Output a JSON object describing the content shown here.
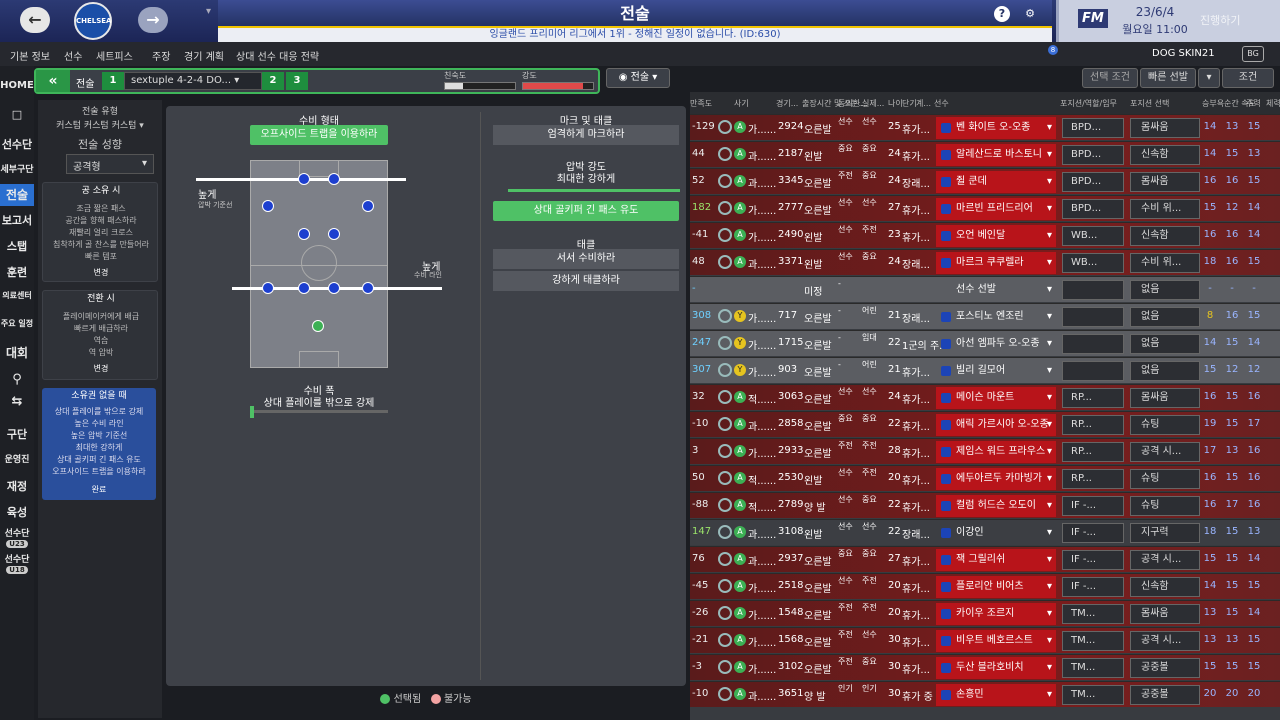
{
  "header": {
    "title": "전술",
    "subtitle": "잉글랜드 프리미어 리그에서 1위 - 정해진 일정이 없습니다. (ID:630)",
    "date": "23/6/4",
    "day_time": "월요일 11:00",
    "continue_label": "진행하기",
    "fm_logo": "FM",
    "crest_text": "CHELSEA"
  },
  "menu": {
    "items": [
      "기본 정보",
      "선수",
      "세트피스",
      "주장",
      "경기 계획",
      "상대 선수 대응 전략"
    ],
    "skin": "DOG SKIN21",
    "notif": "8"
  },
  "nav": {
    "items": [
      "HOME",
      "선수단",
      "세부구단",
      "전술",
      "보고서",
      "스탭",
      "훈련",
      "의료센터",
      "주요 일정",
      "대회",
      "구단",
      "운영진",
      "재정",
      "육성",
      "선수단",
      "선수단"
    ],
    "u23": "U23",
    "u18": "U18"
  },
  "tactic_bar": {
    "label": "전술",
    "slot1": "1",
    "formation": "sextuple 4-2-4 DO...",
    "slot2": "2",
    "slot3": "3",
    "fluency_label": "친숙도",
    "intensity_label": "강도",
    "view": "전술",
    "fluency": 0.25,
    "intensity": 0.85
  },
  "right_buttons": {
    "filter": "선택 조건",
    "quick": "빠른 선발",
    "cond": "조건"
  },
  "left": {
    "style_label": "전술 유형",
    "style_value": "커스텀 커스텀 커스텀",
    "mentality_label": "전술 성향",
    "mentality_value": "공격형",
    "in_possession_title": "공 소유 시",
    "in_possession_lines": [
      "조금 짧은 패스",
      "공간을 향해 패스하라",
      "재빨리 얼리 크로스",
      "침착하게 골 찬스를 만들어라",
      "빠른 템포"
    ],
    "change1": "변경",
    "transition_title": "전환 시",
    "transition_lines": [
      "플레이메이커에게 배급",
      "빠르게 배급하라",
      "역습",
      "역 압박"
    ],
    "change2": "변경",
    "out_possession_title": "소유권 없을 때",
    "out_possession_lines": [
      "상대 플레이를 밖으로 강제",
      "높은 수비 라인",
      "높은 압박 기준선",
      "최대한 강하게",
      "상대 골키퍼 긴 패스 유도",
      "오프사이드 트랩을 이용하라"
    ],
    "done": "완료"
  },
  "center": {
    "def_shape": "수비 형태",
    "offside": "오프사이드 트랩을 이용하라",
    "high_left": "높게",
    "high_left_sub": "압박 기준선",
    "high_right": "높게",
    "high_right_sub": "수비 라인",
    "def_width": "수비 폭",
    "def_width_sub": "상대 플레이를 밖으로 강제",
    "marking_title": "마크 및 태클",
    "marking_btn": "엄격하게 마크하라",
    "press_title": "압박 강도",
    "press_sub": "최대한 강하게",
    "gk_btn": "상대 골키퍼 긴 패스 유도",
    "tackle_title": "태클",
    "tackle1": "서서 수비하라",
    "tackle2": "강하게 태클하라"
  },
  "legend": {
    "selected": "선택됨",
    "unavailable": "불가능"
  },
  "colors": {
    "green": "#4fc166",
    "red": "#b8141a",
    "blue": "#1d3fcf"
  },
  "table": {
    "headers": [
      "만족도",
      "사기",
      "경기...",
      "출장시간 및 쓰는...",
      "동의한...",
      "실제...",
      "나이",
      "단기",
      "계...",
      "선수",
      "포지션/역할/임무",
      "포지션 선택",
      "승부욕",
      "순간 속도",
      "주력",
      "체력"
    ],
    "rows": [
      {
        "s": "-129",
        "r": "A",
        "a": "가......",
        "m": "2924",
        "f": "오른발",
        "c1": "선수",
        "c2": "선수",
        "age": "25",
        "st": "휴가...",
        "name": "벤 화이트 오-오종",
        "role": "BPD...",
        "duty": "몸싸움",
        "v": [
          "14",
          "13",
          "15"
        ],
        "t": "red"
      },
      {
        "s": "44",
        "r": "A",
        "a": "과......",
        "m": "2187",
        "f": "왼발",
        "c1": "중요",
        "c2": "중요",
        "age": "24",
        "st": "휴가...",
        "name": "알레산드로 바스토니",
        "role": "BPD...",
        "duty": "신속함",
        "v": [
          "14",
          "15",
          "13"
        ],
        "t": "red"
      },
      {
        "s": "52",
        "r": "A",
        "a": "과......",
        "m": "3345",
        "f": "오른발",
        "c1": "주전",
        "c2": "중요",
        "age": "24",
        "st": "장래...",
        "name": "쥘 쿤데",
        "role": "BPD...",
        "duty": "몸싸움",
        "v": [
          "16",
          "16",
          "15"
        ],
        "t": "red"
      },
      {
        "s": "182",
        "r": "A",
        "a": "가......",
        "m": "2777",
        "f": "오른발",
        "c1": "선수",
        "c2": "선수",
        "age": "27",
        "st": "휴가...",
        "name": "마르빈 프리드리어",
        "role": "BPD...",
        "duty": "수비 위...",
        "v": [
          "15",
          "12",
          "14"
        ],
        "t": "red"
      },
      {
        "s": "-41",
        "r": "A",
        "a": "가......",
        "m": "2490",
        "f": "왼발",
        "c1": "선수",
        "c2": "주전",
        "age": "23",
        "st": "휴가...",
        "name": "오언 베인달",
        "role": "WB...",
        "duty": "신속함",
        "v": [
          "16",
          "16",
          "14"
        ],
        "t": "red"
      },
      {
        "s": "48",
        "r": "A",
        "a": "과......",
        "m": "3371",
        "f": "왼발",
        "c1": "선수",
        "c2": "중요",
        "age": "24",
        "st": "장래...",
        "name": "마르크 쿠쿠렐라",
        "role": "WB...",
        "duty": "수비 위...",
        "v": [
          "18",
          "16",
          "15"
        ],
        "t": "red"
      },
      {
        "s": "-",
        "r": "",
        "a": "",
        "m": "",
        "f": "미정",
        "c1": "-",
        "c2": "",
        "age": "",
        "st": "",
        "name": "선수 선발",
        "role": "",
        "duty": "없음",
        "v": [
          "-",
          "-",
          "-"
        ],
        "t": "grey"
      },
      {
        "s": "308",
        "r": "Y",
        "a": "가......",
        "m": "717",
        "f": "오른발",
        "c1": "-",
        "c2": "어린",
        "age": "21",
        "st": "장래...",
        "name": "포스티노 엔조린",
        "role": "",
        "duty": "없음",
        "v": [
          "8",
          "16",
          "15"
        ],
        "t": "grey"
      },
      {
        "s": "247",
        "r": "Y",
        "a": "가......",
        "m": "1715",
        "f": "오른발",
        "c1": "-",
        "c2": "임대",
        "age": "22",
        "st": "1군의 주...",
        "name": "아선 엠파두 오-오종",
        "role": "",
        "duty": "없음",
        "v": [
          "14",
          "15",
          "14"
        ],
        "t": "grey"
      },
      {
        "s": "307",
        "r": "Y",
        "a": "가......",
        "m": "903",
        "f": "오른발",
        "c1": "-",
        "c2": "어린",
        "age": "21",
        "st": "휴가...",
        "name": "빌리 길모어",
        "role": "",
        "duty": "없음",
        "v": [
          "15",
          "12",
          "12"
        ],
        "t": "grey"
      },
      {
        "s": "32",
        "r": "A",
        "a": "적......",
        "m": "3063",
        "f": "오른발",
        "c1": "선수",
        "c2": "선수",
        "age": "24",
        "st": "휴가...",
        "name": "메이슨 마운트",
        "role": "RP...",
        "duty": "몸싸움",
        "v": [
          "16",
          "15",
          "16"
        ],
        "t": "red"
      },
      {
        "s": "-10",
        "r": "A",
        "a": "과......",
        "m": "2858",
        "f": "오른발",
        "c1": "중요",
        "c2": "중요",
        "age": "22",
        "st": "휴가...",
        "name": "애릭 가르시아 오-오종",
        "role": "RP...",
        "duty": "슈팅",
        "v": [
          "19",
          "15",
          "17"
        ],
        "t": "red"
      },
      {
        "s": "3",
        "r": "A",
        "a": "가......",
        "m": "2933",
        "f": "오른발",
        "c1": "주전",
        "c2": "주전",
        "age": "28",
        "st": "휴가...",
        "name": "제임스 워드 프라우스",
        "role": "RP...",
        "duty": "공격 시...",
        "v": [
          "17",
          "13",
          "16"
        ],
        "t": "red"
      },
      {
        "s": "50",
        "r": "A",
        "a": "적......",
        "m": "2530",
        "f": "왼발",
        "c1": "선수",
        "c2": "주전",
        "age": "20",
        "st": "휴가...",
        "name": "에두아르두 카마빙가",
        "role": "RP...",
        "duty": "슈팅",
        "v": [
          "16",
          "15",
          "16"
        ],
        "t": "red"
      },
      {
        "s": "-88",
        "r": "A",
        "a": "적......",
        "m": "2789",
        "f": "양 발",
        "c1": "선수",
        "c2": "중요",
        "age": "22",
        "st": "휴가...",
        "name": "컬럼 허드슨 오도이",
        "role": "IF -...",
        "duty": "슈팅",
        "v": [
          "16",
          "17",
          "16"
        ],
        "t": "red"
      },
      {
        "s": "147",
        "r": "A",
        "a": "과......",
        "m": "3108",
        "f": "왼발",
        "c1": "선수",
        "c2": "선수",
        "age": "22",
        "st": "장래...",
        "name": "이강인",
        "role": "IF -...",
        "duty": "지구력",
        "v": [
          "18",
          "15",
          "13"
        ],
        "t": "dark"
      },
      {
        "s": "76",
        "r": "A",
        "a": "과......",
        "m": "2937",
        "f": "오른발",
        "c1": "중요",
        "c2": "중요",
        "age": "27",
        "st": "휴가...",
        "name": "잭 그릴리쉬",
        "role": "IF -...",
        "duty": "공격 시...",
        "v": [
          "15",
          "15",
          "14"
        ],
        "t": "red"
      },
      {
        "s": "-45",
        "r": "A",
        "a": "가......",
        "m": "2518",
        "f": "오른발",
        "c1": "선수",
        "c2": "주전",
        "age": "20",
        "st": "휴가...",
        "name": "플로리안 비어츠",
        "role": "IF -...",
        "duty": "신속함",
        "v": [
          "14",
          "15",
          "15"
        ],
        "t": "red"
      },
      {
        "s": "-26",
        "r": "A",
        "a": "가......",
        "m": "1548",
        "f": "오른발",
        "c1": "주전",
        "c2": "주전",
        "age": "20",
        "st": "휴가...",
        "name": "카이우 조르지",
        "role": "TM...",
        "duty": "몸싸움",
        "v": [
          "13",
          "15",
          "14"
        ],
        "t": "red"
      },
      {
        "s": "-21",
        "r": "A",
        "a": "가......",
        "m": "1568",
        "f": "오른발",
        "c1": "주전",
        "c2": "선수",
        "age": "30",
        "st": "휴가...",
        "name": "비우트 베호르스트",
        "role": "TM...",
        "duty": "공격 시...",
        "v": [
          "13",
          "13",
          "15"
        ],
        "t": "red"
      },
      {
        "s": "-3",
        "r": "A",
        "a": "가......",
        "m": "3102",
        "f": "오른발",
        "c1": "주전",
        "c2": "중요",
        "age": "30",
        "st": "휴가...",
        "name": "두산 블라호비치",
        "role": "TM...",
        "duty": "공중볼",
        "v": [
          "15",
          "15",
          "15"
        ],
        "t": "red"
      },
      {
        "s": "-10",
        "r": "A",
        "a": "과......",
        "m": "3651",
        "f": "양 발",
        "c1": "인기",
        "c2": "인기",
        "age": "30",
        "st": "휴가 중",
        "name": "손흥민",
        "role": "TM...",
        "duty": "공중볼",
        "v": [
          "20",
          "20",
          "20"
        ],
        "t": "red"
      }
    ]
  }
}
